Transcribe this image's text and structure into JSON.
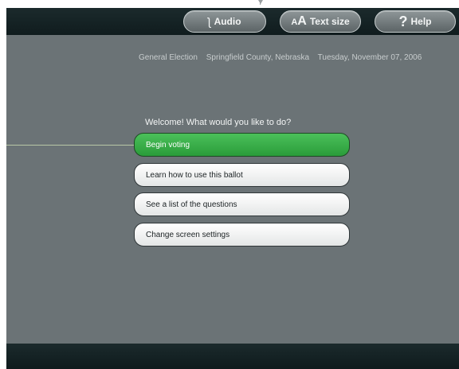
{
  "toolbar": {
    "audio_label": "Audio",
    "audio_icon": "ear-icon",
    "textsize_label": "Text size",
    "textsize_icon_small": "A",
    "textsize_icon_big": "A",
    "help_label": "Help",
    "help_icon": "?"
  },
  "header": {
    "election": "General Election",
    "location": "Springfield County, Nebraska",
    "date": "Tuesday, November 07, 2006"
  },
  "main": {
    "prompt": "Welcome! What would you like to do?",
    "options": [
      {
        "label": "Begin voting"
      },
      {
        "label": "Learn how to use this ballot"
      },
      {
        "label": "See a list of the questions"
      },
      {
        "label": "Change screen settings"
      }
    ]
  },
  "colors": {
    "background": "#6b7376",
    "bar": "#14222",
    "primary_button": "#3bb04a"
  }
}
